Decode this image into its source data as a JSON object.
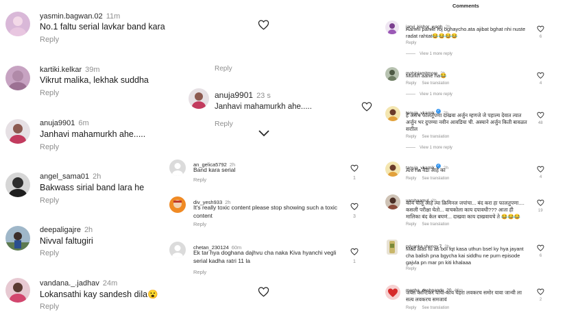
{
  "left": {
    "comments": [
      {
        "user": "yasmin.bagwan.02",
        "time": "11m",
        "text": "No.1 faltu serial lavkar band kara",
        "reply": "Reply"
      },
      {
        "user": "kartiki.kelkar",
        "time": "39m",
        "text": "Vikrut malika, lekhak suddha",
        "reply": "Reply"
      },
      {
        "user": "anuja9901",
        "time": "6m",
        "text": "Janhavi mahamurkh ahe.....",
        "reply": "Reply"
      },
      {
        "user": "angel_sama01",
        "time": "2h",
        "text": "Bakwass sirial  band lara he",
        "reply": "Reply"
      },
      {
        "user": "deepaligajre",
        "time": "2h",
        "text": "Nivval faltugiri",
        "reply": "Reply"
      },
      {
        "user": "vandana._.jadhav",
        "time": "24m",
        "text": "Lokansathi kay sandesh dila😮",
        "reply": "Reply"
      }
    ]
  },
  "mid": {
    "top_reply": "Reply",
    "featured": {
      "user": "anuja9901",
      "time": "23 s",
      "text": "Janhavi mahamurkh ahe.....",
      "reply": "Reply"
    },
    "comments": [
      {
        "user": "an_gelica5792",
        "time": "2h",
        "text": "Band kara serial",
        "reply": "Reply",
        "likes": "1"
      },
      {
        "user": "div_yesh933",
        "time": "2h",
        "text": "It's really toxic content please stop showing such a toxic content",
        "reply": "Reply",
        "likes": "3"
      },
      {
        "user": "chetan_230124",
        "time": "60m",
        "text": "Ek tar hya doghana dajhvu cha naka Kiva hyanchi vegli serial kadha ratri 11 la",
        "reply": "Reply",
        "likes": "1"
      }
    ]
  },
  "right": {
    "header": "Comments",
    "comments": [
      {
        "user": "janvi_kishor_wagh",
        "time": "2h",
        "text": "Aamhi pahile roj bghaycho.ata ajibat bghat nhi nuste radat rahtat😂😂😂😂",
        "reply": "Reply",
        "translate": "",
        "likes": "6",
        "view_more": "View 1 more reply"
      },
      {
        "user": "mohiniamitmore",
        "time": "2h",
        "text": "Murkh aahe ha😂",
        "reply": "Reply",
        "translate": "See translation",
        "likes": "4",
        "view_more": "View 1 more reply"
      },
      {
        "user": "tanuja_vkarnik",
        "time": "2h",
        "text": "हे असंच फालतूपणा दाखवा अर्जुन म्हणजे जे पहाल्य देवात त्यात अर्जुन भर दुपण्या नवीन आवडिया ची. अस्याने अर्जुन किती बावळत सराील",
        "reply": "Reply",
        "translate": "See translation",
        "likes": "48",
        "view_more": "View 1 more reply"
      },
      {
        "user": "tanuja_vkarnik",
        "time": "2h",
        "text": "Are ha वेडा आहे का",
        "reply": "Reply",
        "translate": "See translation",
        "likes": "4",
        "view_more": ""
      },
      {
        "user": "varshaamul",
        "time": "2h",
        "text": "काय चालू आहे त्या क्रिमिनल जपांचा... बंद करा हा फालतुपणा.... कसली परीक्षा घेतो... वाचकोला काय दपावधी??? आता ही मालिका बंद केल बघणं... दाखवा काय दाखवायचे ते 😂😂😂",
        "reply": "Reply",
        "translate": "See translation",
        "likes": "19",
        "view_more": ""
      },
      {
        "user": "priyanka.shenoy.7",
        "time": "2h",
        "text": "Mad alas tu as bol fqt kasa uthun bsel ky hya jayant cha balish pna bgycha  kai siddhu ne purn episode gajvla pn mar pn kiti khalaaa",
        "reply": "Reply",
        "translate": "",
        "likes": "6",
        "view_more": ""
      },
      {
        "user": "megha_deshpande_20",
        "time": "48m",
        "text": "जयंत कान्टिकर यांचा काय चेहरा लवकरच समोर यावा जान्वी ला सत्य लवकरच समजावं",
        "reply": "Reply",
        "translate": "See translation",
        "likes": "2",
        "view_more": ""
      }
    ]
  },
  "colors": {
    "text": "#262626",
    "secondary": "#8e8e8e",
    "verified": "#3897f0"
  },
  "icons": {
    "like": "heart-outline-icon",
    "expand": "chevron-down-icon",
    "verified": "verified-badge-icon"
  }
}
